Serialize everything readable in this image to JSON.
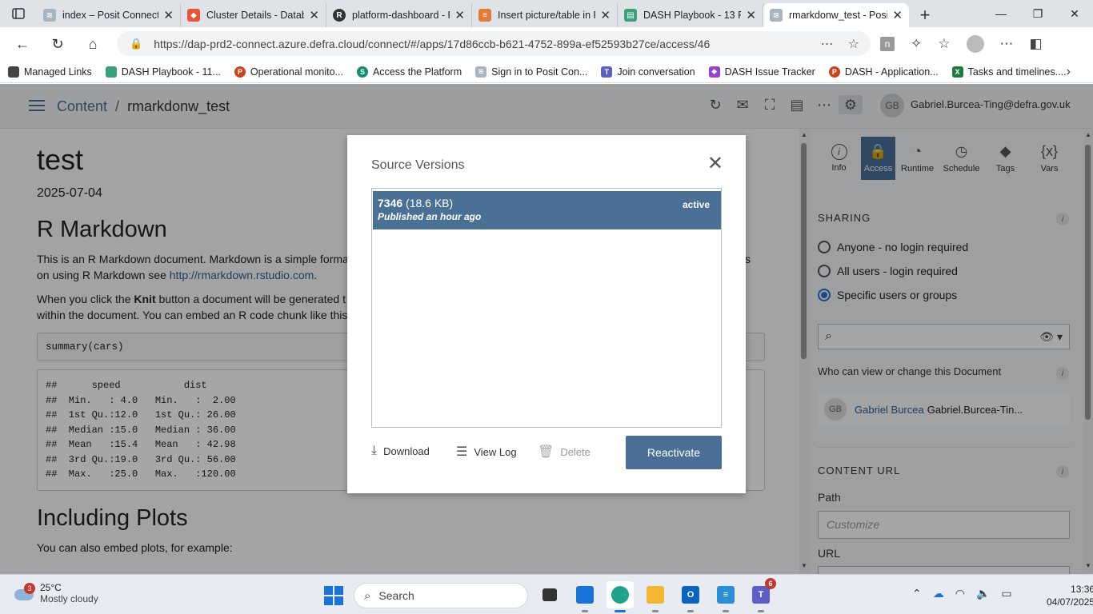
{
  "browser": {
    "tabs": [
      {
        "title": "index – Posit Connect D",
        "color": "#aab4c0"
      },
      {
        "title": "Cluster Details - Datab",
        "color": "#e8533a"
      },
      {
        "title": "platform-dashboard - R",
        "color": "#333333"
      },
      {
        "title": "Insert picture/table in R",
        "color": "#e07b39"
      },
      {
        "title": "DASH Playbook - 13 P",
        "color": "#3aa07a"
      },
      {
        "title": "rmarkdonw_test - Posit",
        "color": "#aab4c0"
      }
    ],
    "url": "https://dap-prd2-connect.azure.defra.cloud/connect/#/apps/17d86ccb-b621-4752-899a-ef52593b27ce/access/46",
    "bookmarks": [
      {
        "label": "Managed Links",
        "color": "#444444"
      },
      {
        "label": "DASH Playbook - 11...",
        "color": "#3aa07a"
      },
      {
        "label": "Operational monito...",
        "color": "#c8431e"
      },
      {
        "label": "Access the Platform",
        "color": "#148c6e"
      },
      {
        "label": "Sign in to Posit Con...",
        "color": "#aab4c0"
      },
      {
        "label": "Join conversation",
        "color": "#5b5fc7"
      },
      {
        "label": "DASH Issue Tracker",
        "color": "#9b3fd0"
      },
      {
        "label": "DASH - Application...",
        "color": "#c8431e"
      },
      {
        "label": "Tasks and timelines....",
        "color": "#1e7a3e"
      }
    ]
  },
  "header": {
    "crumb_root": "Content",
    "crumb_sep": "/",
    "crumb_current": "rmarkdonw_test",
    "avatar_initials": "GB",
    "user_email": "Gabriel.Burcea-Ting@defra.gov.uk"
  },
  "document": {
    "title": "test",
    "date": "2025-07-04",
    "h2_1": "R Markdown",
    "p1_a": "This is an R Markdown document. Markdown is a simple forma",
    "p1_b": "s",
    "p1_c": "on using R Markdown see ",
    "p1_link": "http://rmarkdown.rstudio.com",
    "p1_d": ".",
    "p2_a": "When you click the ",
    "p2_bold": "Knit",
    "p2_b": " button a document will be generated t",
    "p2_c": "within the document. You can embed an R code chunk like this",
    "code": "summary(cars)",
    "output": "##      speed           dist       \n##  Min.   : 4.0   Min.   :  2.00  \n##  1st Qu.:12.0   1st Qu.: 26.00  \n##  Median :15.0   Median : 36.00  \n##  Mean   :15.4   Mean   : 42.98  \n##  3rd Qu.:19.0   3rd Qu.: 56.00  \n##  Max.   :25.0   Max.   :120.00  ",
    "h2_2": "Including Plots",
    "p3": "You can also embed plots, for example:"
  },
  "panel": {
    "tabs": [
      {
        "label": "Info",
        "icon": "i"
      },
      {
        "label": "Access",
        "icon": "🔒"
      },
      {
        "label": "Runtime",
        "icon": "◔"
      },
      {
        "label": "Schedule",
        "icon": "◷"
      },
      {
        "label": "Tags",
        "icon": "◆"
      },
      {
        "label": "Vars",
        "icon": "{x}"
      }
    ],
    "sharing_title": "SHARING",
    "options": [
      "Anyone - no login required",
      "All users - login required",
      "Specific users or groups"
    ],
    "selected_option": 2,
    "who_label": "Who can view or change this Document",
    "user_initials": "GB",
    "user_name": "Gabriel Burcea",
    "user_login": "Gabriel.Burcea-Tin...",
    "content_url_title": "CONTENT URL",
    "path_label": "Path",
    "path_placeholder": "Customize",
    "url_label": "URL"
  },
  "modal": {
    "title": "Source Versions",
    "version_id": "7346",
    "version_size": "(18.6 KB)",
    "version_published": "Published an hour ago",
    "version_status": "active",
    "download_label": "Download",
    "viewlog_label": "View Log",
    "delete_label": "Delete",
    "reactivate_label": "Reactivate"
  },
  "taskbar": {
    "weather_badge": "3",
    "temperature": "25°C",
    "conditions": "Mostly cloudy",
    "search_label": "Search",
    "teams_badge": "6",
    "time": "13:36",
    "date": "04/07/2025"
  }
}
